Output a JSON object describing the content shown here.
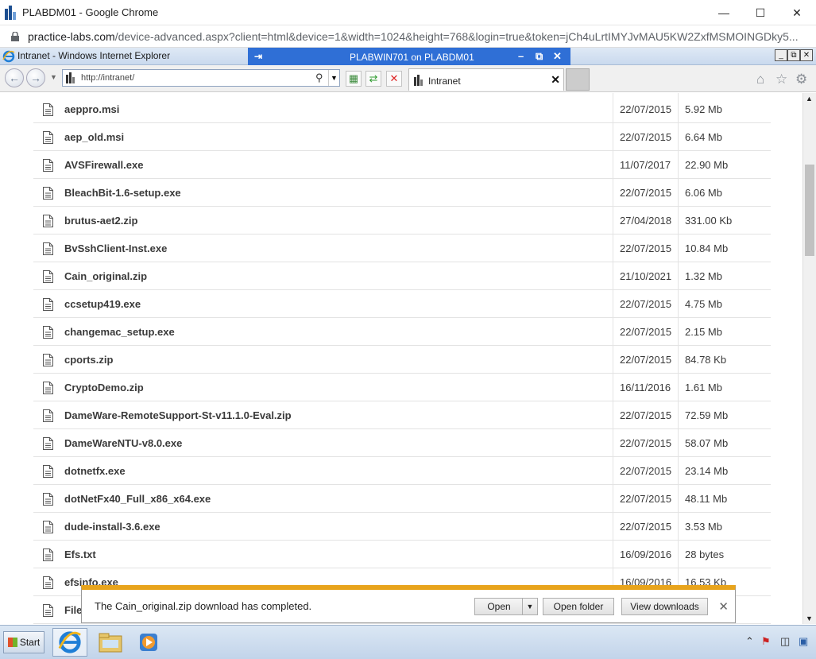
{
  "chrome": {
    "window_title": "PLABDM01 - Google Chrome",
    "url_domain": "practice-labs.com",
    "url_path": "/device-advanced.aspx?client=html&device=1&width=1024&height=768&login=true&token=jCh4uLrtIMYJvMAU5KW2ZxfMSMOINGDky5..."
  },
  "ie": {
    "window_title": "Intranet - Windows Internet Explorer",
    "rdp_title": "PLABWIN701 on PLABDM01",
    "address": "http://intranet/",
    "tab_label": "Intranet"
  },
  "files": [
    {
      "name": "aeppro.msi",
      "date": "22/07/2015",
      "size": "5.92 Mb"
    },
    {
      "name": "aep_old.msi",
      "date": "22/07/2015",
      "size": "6.64 Mb"
    },
    {
      "name": "AVSFirewall.exe",
      "date": "11/07/2017",
      "size": "22.90 Mb"
    },
    {
      "name": "BleachBit-1.6-setup.exe",
      "date": "22/07/2015",
      "size": "6.06 Mb"
    },
    {
      "name": "brutus-aet2.zip",
      "date": "27/04/2018",
      "size": "331.00 Kb"
    },
    {
      "name": "BvSshClient-Inst.exe",
      "date": "22/07/2015",
      "size": "10.84 Mb"
    },
    {
      "name": "Cain_original.zip",
      "date": "21/10/2021",
      "size": "1.32 Mb"
    },
    {
      "name": "ccsetup419.exe",
      "date": "22/07/2015",
      "size": "4.75 Mb"
    },
    {
      "name": "changemac_setup.exe",
      "date": "22/07/2015",
      "size": "2.15 Mb"
    },
    {
      "name": "cports.zip",
      "date": "22/07/2015",
      "size": "84.78 Kb"
    },
    {
      "name": "CryptoDemo.zip",
      "date": "16/11/2016",
      "size": "1.61 Mb"
    },
    {
      "name": "DameWare-RemoteSupport-St-v11.1.0-Eval.zip",
      "date": "22/07/2015",
      "size": "72.59 Mb"
    },
    {
      "name": "DameWareNTU-v8.0.exe",
      "date": "22/07/2015",
      "size": "58.07 Mb"
    },
    {
      "name": "dotnetfx.exe",
      "date": "22/07/2015",
      "size": "23.14 Mb"
    },
    {
      "name": "dotNetFx40_Full_x86_x64.exe",
      "date": "22/07/2015",
      "size": "48.11 Mb"
    },
    {
      "name": "dude-install-3.6.exe",
      "date": "22/07/2015",
      "size": "3.53 Mb"
    },
    {
      "name": "Efs.txt",
      "date": "16/09/2016",
      "size": "28 bytes"
    },
    {
      "name": "efsinfo.exe",
      "date": "16/09/2016",
      "size": "16.53 Kb"
    },
    {
      "name": "File",
      "date": "",
      "size": ""
    }
  ],
  "download": {
    "message": "The Cain_original.zip download has completed.",
    "open_label": "Open",
    "open_folder_label": "Open folder",
    "view_downloads_label": "View downloads"
  },
  "taskbar": {
    "start_label": "Start"
  }
}
